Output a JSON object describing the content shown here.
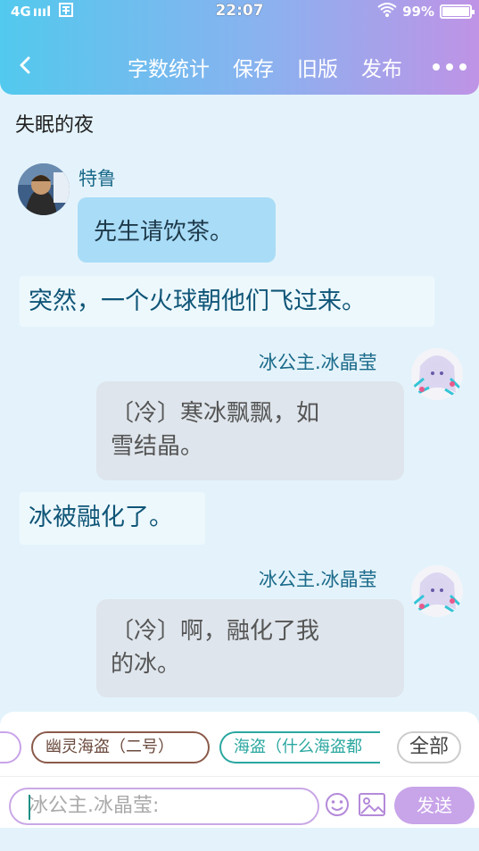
{
  "status_bar": {
    "network": "4G",
    "signal_bars": "ıııl",
    "time": "22:07",
    "battery_percent": "99%",
    "battery_level": 0.99
  },
  "nav": {
    "items": [
      "字数统计",
      "保存",
      "旧版",
      "发布"
    ]
  },
  "chat_title": "失眠的夜",
  "messages": [
    {
      "type": "dialog-left",
      "sender": "特鲁",
      "text": "先生请饮茶。"
    },
    {
      "type": "narration",
      "text": "突然，一个火球朝他们飞过来。"
    },
    {
      "type": "dialog-right",
      "sender": "冰公主.冰晶莹",
      "lines": [
        "〔冷〕寒冰飘飘，如",
        "雪结晶。"
      ]
    },
    {
      "type": "narration",
      "text": "冰被融化了。"
    },
    {
      "type": "dialog-right",
      "sender": "冰公主.冰晶莹",
      "lines": [
        "〔冷〕啊，融化了我",
        "的冰。"
      ]
    }
  ],
  "role_chips": [
    {
      "label": "幽灵海盗（二号）",
      "color": "#8a5a4a"
    },
    {
      "label": "海盗（什么海盗都",
      "color": "#2aa7a0"
    }
  ],
  "all_button": "全部",
  "input": {
    "placeholder": "冰公主.冰晶莹:"
  },
  "send_button": "发送",
  "colors": {
    "header_gradient_start": "#52c9ee",
    "header_gradient_end": "#bf93e6",
    "chat_bg": "#e4f3fb",
    "send_button": "#c8a4e9"
  }
}
